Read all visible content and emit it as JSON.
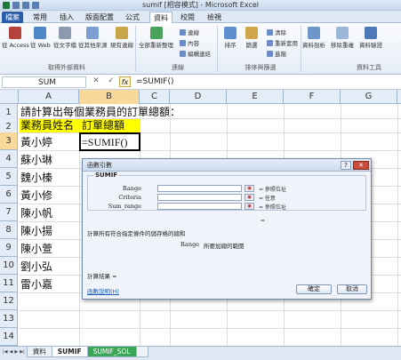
{
  "window": {
    "title": "sumif  [相容模式] - Microsoft Excel"
  },
  "tabs": [
    {
      "label": "檔案"
    },
    {
      "label": "常用"
    },
    {
      "label": "插入"
    },
    {
      "label": "版面配置"
    },
    {
      "label": "公式"
    },
    {
      "label": "資料"
    },
    {
      "label": "校閱"
    },
    {
      "label": "檢視"
    }
  ],
  "ribbon": {
    "buttons": [
      "從 Access",
      "從 Web",
      "從文字檔",
      "從其他來源",
      "現有連線",
      "全部重新整理",
      "排序",
      "篩選",
      "資料剖析",
      "移除重複",
      "資料驗證"
    ],
    "small": [
      "連線",
      "內容",
      "編輯連結",
      "清除",
      "重新套用",
      "進階"
    ],
    "groups": [
      "取得外部資料",
      "連線",
      "排序與篩選",
      "資料工具"
    ]
  },
  "formula_bar": {
    "name_box": "SUM",
    "cancel": "✕",
    "enter": "✓",
    "fx": "fx",
    "value": "=SUMIF()"
  },
  "columns": [
    "A",
    "B",
    "C",
    "D",
    "E",
    "F",
    "G",
    "H"
  ],
  "rows": [
    "1",
    "2",
    "3",
    "4",
    "5",
    "6",
    "7",
    "8",
    "9",
    "10",
    "11",
    "12",
    "13",
    "14"
  ],
  "cells": {
    "a1": "請計算出每個業務員的訂單總額：",
    "a2": "業務員姓名",
    "b2": "訂單總額",
    "b3": "=SUMIF()",
    "names": [
      "黃小婷",
      "蘇小琳",
      "魏小榛",
      "黃小修",
      "陳小帆",
      "陳小揚",
      "陳小萱",
      "劉小弘",
      "雷小嘉"
    ]
  },
  "dialog": {
    "title": "函數引數",
    "help_q": "?",
    "close": "✕",
    "func": "SUMIF",
    "args": [
      {
        "label": "Range",
        "result": "= 參照位址"
      },
      {
        "label": "Criteria",
        "result": "= 任意"
      },
      {
        "label": "Sum_range",
        "result": "= 參照位址"
      }
    ],
    "eq": "=",
    "description": "計算所有符合指定條件的儲存格的總和",
    "arg_name": "Range",
    "arg_desc": "所要加總的範圍",
    "result_label": "計算結果 =",
    "help_link": "函數說明(H)",
    "ok": "確定",
    "cancel": "取消"
  },
  "sheet_tabs": [
    "資料",
    "SUMIF",
    "SUMIF_SOL"
  ]
}
